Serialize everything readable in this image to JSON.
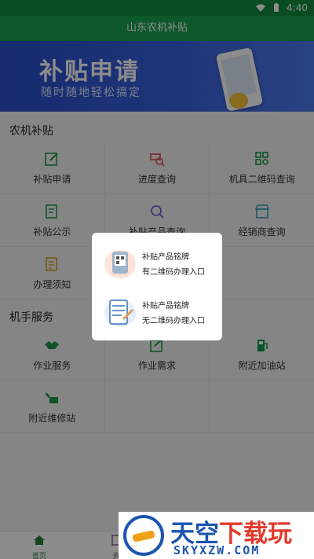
{
  "status_bar": {
    "time": "4:40"
  },
  "app_bar": {
    "title": "山东农机补贴"
  },
  "banner": {
    "title": "补贴申请",
    "subtitle": "随时随地轻松搞定"
  },
  "sections": [
    {
      "title": "农机补贴",
      "items": [
        {
          "label": "补贴申请",
          "icon": "edit-icon",
          "color": "#1a9a4a"
        },
        {
          "label": "进度查询",
          "icon": "progress-search-icon",
          "color": "#e34b4b"
        },
        {
          "label": "机具二维码查询",
          "icon": "qr-grid-icon",
          "color": "#1a9a4a"
        },
        {
          "label": "补贴公示",
          "icon": "notice-icon",
          "color": "#1a9a4a"
        },
        {
          "label": "补贴产品查询",
          "icon": "product-search-icon",
          "color": "#6b4fd6"
        },
        {
          "label": "经销商查询",
          "icon": "store-icon",
          "color": "#3aa0b8"
        },
        {
          "label": "办理须知",
          "icon": "document-icon",
          "color": "#d9a020"
        }
      ]
    },
    {
      "title": "机手服务",
      "items": [
        {
          "label": "作业服务",
          "icon": "handshake-icon",
          "color": "#1a9a4a"
        },
        {
          "label": "作业需求",
          "icon": "demand-icon",
          "color": "#1a9a4a"
        },
        {
          "label": "附近加油站",
          "icon": "gas-station-icon",
          "color": "#1a9a4a"
        },
        {
          "label": "附近维修站",
          "icon": "repair-icon",
          "color": "#1a9a4a"
        }
      ]
    }
  ],
  "dialog": {
    "options": [
      {
        "line1": "补贴产品铭牌",
        "line2": "有二维码办理入口",
        "icon": "qr-nameplate-icon"
      },
      {
        "line1": "补贴产品铭牌",
        "line2": "无二维码办理入口",
        "icon": "checklist-clipboard-icon"
      }
    ]
  },
  "tab_bar": {
    "tabs": [
      {
        "label": "首页",
        "active": true
      },
      {
        "label": "资"
      }
    ]
  },
  "watermark": {
    "logo_text_1": "天空",
    "logo_text_2": "下载玩",
    "domain": "SKYXZW.COM"
  },
  "colors": {
    "primary": "#16a04a",
    "banner": "#3a63df",
    "overlay": "rgba(0,0,0,0.45)"
  }
}
